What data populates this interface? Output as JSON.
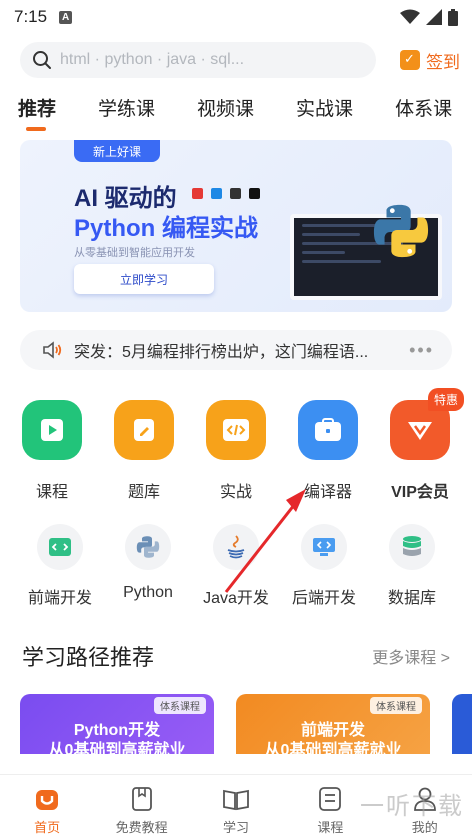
{
  "status": {
    "time": "7:15",
    "notif": "A"
  },
  "search": {
    "placeholder": "html · python · java · sql..."
  },
  "signin": {
    "label": "签到"
  },
  "tabs": [
    {
      "label": "推荐"
    },
    {
      "label": "学练课"
    },
    {
      "label": "视频课"
    },
    {
      "label": "实战课"
    },
    {
      "label": "体系课"
    }
  ],
  "banner": {
    "tag": "新上好课",
    "line1": "AI 驱动的",
    "line2": "Python 编程实战",
    "sub": "从零基础到智能应用开发",
    "cta": "立即学习"
  },
  "notice": {
    "text": "突发：5月编程排行榜出炉，这门编程语..."
  },
  "features": [
    {
      "label": "课程",
      "color": "#22c47a",
      "icon": "play-icon"
    },
    {
      "label": "题库",
      "color": "#f7a21a",
      "icon": "edit-icon"
    },
    {
      "label": "实战",
      "color": "#f7a21a",
      "icon": "code-icon"
    },
    {
      "label": "编译器",
      "color": "#3c8ff2",
      "icon": "compiler-icon"
    },
    {
      "label": "VIP会员",
      "color": "#f25a2a",
      "icon": "vip-icon",
      "badge": "特惠"
    }
  ],
  "categories": [
    {
      "label": "前端开发",
      "icon": "frontend-icon"
    },
    {
      "label": "Python",
      "icon": "python-icon"
    },
    {
      "label": "Java开发",
      "icon": "java-icon"
    },
    {
      "label": "后端开发",
      "icon": "backend-icon"
    },
    {
      "label": "数据库",
      "icon": "database-icon"
    }
  ],
  "section": {
    "title": "学习路径推荐",
    "more": "更多课程 >"
  },
  "courses": [
    {
      "tag": "体系课程",
      "line1": "Python开发",
      "line2": "从0基础到高薪就业"
    },
    {
      "tag": "体系课程",
      "line1": "前端开发",
      "line2": "从0基础到高薪就业"
    }
  ],
  "bottom_nav": [
    {
      "label": "首页",
      "icon": "home-icon"
    },
    {
      "label": "免费教程",
      "icon": "book-icon"
    },
    {
      "label": "学习",
      "icon": "open-book-icon"
    },
    {
      "label": "课程",
      "icon": "course-icon"
    },
    {
      "label": "我的",
      "icon": "profile-icon"
    }
  ],
  "watermark": "一听下载"
}
